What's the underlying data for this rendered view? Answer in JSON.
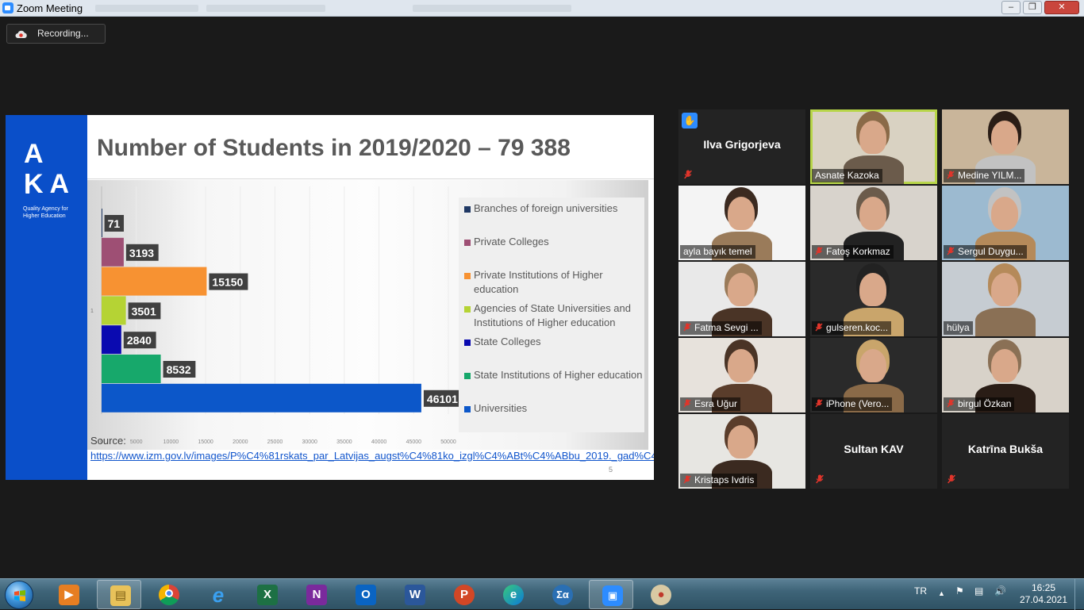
{
  "window": {
    "title": "Zoom Meeting"
  },
  "recording": {
    "label": "Recording..."
  },
  "slide": {
    "logo_line1": "A i",
    "logo_line2": "KA",
    "tagline": "Quality Agency for Higher Education",
    "title": "Number of Students in 2019/2020 – 79 388",
    "source_label": "Source:",
    "source_url": "https://www.izm.gov.lv/images/P%C4%81rskats_par_Latvijas_augst%C4%81ko_izgl%C4%ABt%C4%ABbu_2019._gad%C4%81.pdf",
    "page_number": "5"
  },
  "chart_data": {
    "type": "bar",
    "orientation": "horizontal",
    "categories": [
      "Branches of foreign universities",
      "Private Colleges",
      "Private Institutions of Higher education",
      "Agencies of State Universities and Institutions of Higher education",
      "State Colleges",
      "State Institutions of Higher education",
      "Universities"
    ],
    "values": [
      71,
      3193,
      15150,
      3501,
      2840,
      8532,
      46101
    ],
    "colors": [
      "#1f3864",
      "#9e4f74",
      "#f79232",
      "#b5d334",
      "#0a0ab0",
      "#17a86b",
      "#0c57c9"
    ],
    "data_labels": [
      "71",
      "3193",
      "15150",
      "3501",
      "2840",
      "8532",
      "46101"
    ],
    "x_ticks": [
      "0",
      "5000",
      "10000",
      "15000",
      "20000",
      "25000",
      "30000",
      "35000",
      "40000",
      "45000",
      "50000"
    ],
    "xlim": [
      0,
      50000
    ],
    "y_axis_label": "1",
    "legend_position": "right"
  },
  "participants": [
    {
      "name": "Ilva Grigorjeva",
      "video": false,
      "muted": true,
      "hand_raised": true,
      "active": false
    },
    {
      "name": "Asnate Kazoka",
      "video": true,
      "muted": false,
      "active": true
    },
    {
      "name": "Medine YILM...",
      "video": true,
      "muted": true,
      "active": false
    },
    {
      "name": "ayla bayık temel",
      "video": true,
      "muted": false,
      "active": false
    },
    {
      "name": "Fatoş Korkmaz",
      "video": true,
      "muted": true,
      "active": false
    },
    {
      "name": "Sergul Duygu...",
      "video": true,
      "muted": true,
      "active": false
    },
    {
      "name": "Fatma Sevgi ...",
      "video": true,
      "muted": true,
      "active": false
    },
    {
      "name": "gulseren.koc...",
      "video": true,
      "muted": true,
      "active": false
    },
    {
      "name": "hülya",
      "video": true,
      "muted": false,
      "active": false
    },
    {
      "name": "Esra Uğur",
      "video": true,
      "muted": true,
      "active": false
    },
    {
      "name": "iPhone (Vero...",
      "video": true,
      "muted": true,
      "active": false
    },
    {
      "name": "birgul Özkan",
      "video": true,
      "muted": true,
      "active": false
    },
    {
      "name": "Kristaps Ivdris",
      "video": true,
      "muted": true,
      "active": false
    },
    {
      "name": "Sultan KAV",
      "video": false,
      "muted": true,
      "active": false
    },
    {
      "name": "Katrīna Bukša",
      "video": false,
      "muted": true,
      "active": false
    }
  ],
  "taskbar": {
    "apps": [
      "start",
      "media-player",
      "file-explorer",
      "chrome",
      "internet-explorer",
      "excel",
      "onenote",
      "outlook",
      "word",
      "powerpoint",
      "edge",
      "math-input",
      "zoom",
      "paint"
    ],
    "language": "TR",
    "time": "16:25",
    "date": "27.04.2021"
  }
}
